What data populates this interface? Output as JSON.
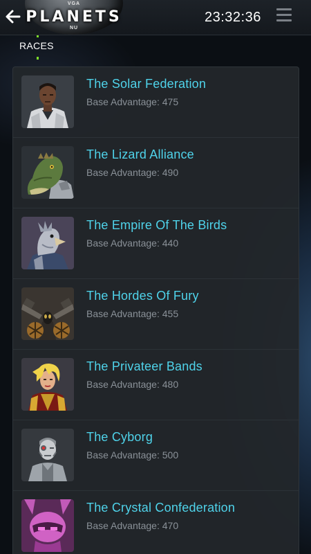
{
  "header": {
    "logo_top": "VGA",
    "logo_main": "PLANETS",
    "logo_bottom": "NU",
    "clock": "23:32:36"
  },
  "section": {
    "title": "RACES"
  },
  "colors": {
    "accent": "#4fd3ea",
    "subtext": "#8a9198",
    "panel": "#22272b",
    "tick": "#7cdc2a"
  },
  "races": [
    {
      "name": "The Solar Federation",
      "advantage": "Base Advantage: 475",
      "portrait": "human-officer-portrait"
    },
    {
      "name": "The Lizard Alliance",
      "advantage": "Base Advantage: 490",
      "portrait": "lizard-portrait"
    },
    {
      "name": "The Empire Of The Birds",
      "advantage": "Base Advantage: 440",
      "portrait": "bird-portrait"
    },
    {
      "name": "The Hordes Of Fury",
      "advantage": "Base Advantage: 455",
      "portrait": "insect-warrior-portrait"
    },
    {
      "name": "The Privateer Bands",
      "advantage": "Base Advantage: 480",
      "portrait": "privateer-portrait"
    },
    {
      "name": "The Cyborg",
      "advantage": "Base Advantage: 500",
      "portrait": "cyborg-portrait"
    },
    {
      "name": "The Crystal Confederation",
      "advantage": "Base Advantage: 470",
      "portrait": "crystal-portrait"
    }
  ]
}
